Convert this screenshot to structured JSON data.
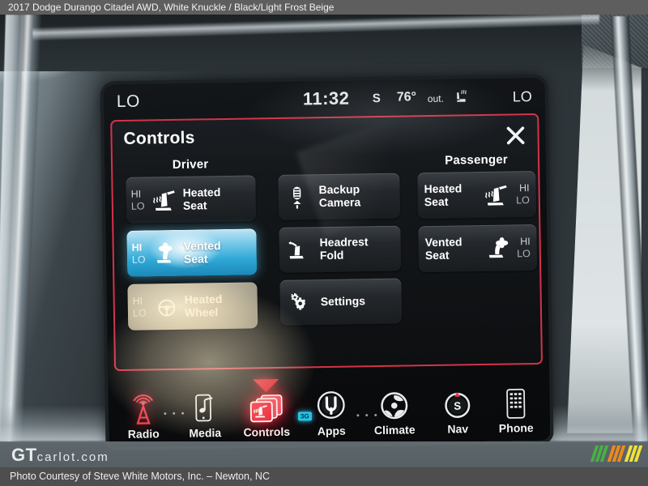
{
  "caption": {
    "top": "2017 Dodge Durango Citadel AWD,  White Knuckle / Black/Light Frost Beige",
    "bottom": "Photo Courtesy of Steve White Motors, Inc. – Newton, NC"
  },
  "watermark": {
    "brand_bold": "GT",
    "brand_rest": "carlot.com",
    "bar_colors": [
      "#49b044",
      "#f08a1c",
      "#f2e23a"
    ]
  },
  "statusbar": {
    "left_temp": "LO",
    "clock": "11:32",
    "mode": "S",
    "outside_temp": "76°",
    "outside_label": "out.",
    "seat_icon": "heated-seat-indicator-icon",
    "right_temp": "LO"
  },
  "panel": {
    "title": "Controls",
    "close_icon": "close-icon",
    "accent_color": "#d4334a",
    "driver": {
      "heading": "Driver",
      "buttons": [
        {
          "label": "Heated\nSeat",
          "label_line1": "Heated",
          "label_line2": "Seat",
          "hi": "HI",
          "lo": "LO",
          "icon": "heated-seat-icon",
          "state": "off"
        },
        {
          "label": "Vented\nSeat",
          "label_line1": "Vented",
          "label_line2": "Seat",
          "hi": "HI",
          "lo": "LO",
          "icon": "vented-seat-icon",
          "state": "active-hi"
        },
        {
          "label": "Heated\nWheel",
          "label_line1": "Heated",
          "label_line2": "Wheel",
          "hi": "HI",
          "lo": "LO",
          "icon": "heated-steering-wheel-icon",
          "state": "glare"
        }
      ]
    },
    "middle": {
      "buttons": [
        {
          "label_line1": "Backup",
          "label_line2": "Camera",
          "icon": "backup-camera-icon"
        },
        {
          "label_line1": "Headrest",
          "label_line2": "Fold",
          "icon": "headrest-fold-icon"
        },
        {
          "label_line1": "Settings",
          "label_line2": "",
          "icon": "gear-icon"
        }
      ]
    },
    "passenger": {
      "heading": "Passenger",
      "buttons": [
        {
          "label_line1": "Heated",
          "label_line2": "Seat",
          "hi": "HI",
          "lo": "LO",
          "icon": "heated-seat-icon",
          "state": "off"
        },
        {
          "label_line1": "Vented",
          "label_line2": "Seat",
          "hi": "HI",
          "lo": "LO",
          "icon": "vented-seat-icon",
          "state": "off"
        }
      ]
    }
  },
  "navbar": {
    "items": [
      {
        "label": "Radio",
        "icon": "radio-tower-icon",
        "active": false,
        "badge": ""
      },
      {
        "label": "Media",
        "icon": "media-note-icon",
        "active": false,
        "badge": ""
      },
      {
        "label": "Controls",
        "icon": "controls-cards-icon",
        "active": true,
        "badge": ""
      },
      {
        "label": "Apps",
        "icon": "apps-uconnect-icon",
        "active": false,
        "badge": "3G"
      },
      {
        "label": "Climate",
        "icon": "climate-fan-icon",
        "active": false,
        "badge": ""
      },
      {
        "label": "Nav",
        "icon": "nav-compass-icon",
        "active": false,
        "badge": ""
      },
      {
        "label": "Phone",
        "icon": "phone-keypad-icon",
        "active": false,
        "badge": ""
      }
    ],
    "compass_letter": "S"
  }
}
